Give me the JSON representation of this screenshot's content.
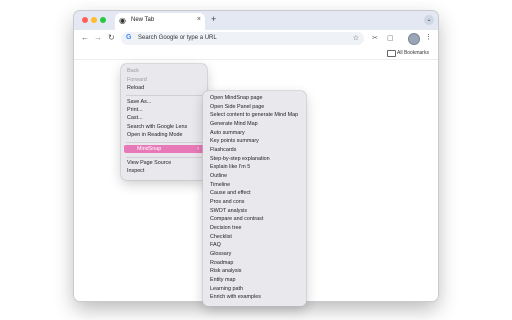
{
  "browser": {
    "tab_title": "New Tab",
    "tab_close": "×",
    "new_tab": "+",
    "omnibox_placeholder": "Search Google or type a URL",
    "bookmarks_label": "All Bookmarks"
  },
  "context_menu": {
    "items": [
      "Back",
      "Forward",
      "Reload",
      "Save As...",
      "Print...",
      "Cast...",
      "Search with Google Lens",
      "Open in Reading Mode",
      "MindSnap",
      "View Page Source",
      "Inspect"
    ]
  },
  "submenu": {
    "items": [
      "Open MindSnap page",
      "Open Side Panel page",
      "Select content to generate Mind Map",
      "Generate Mind Map",
      "Auto summary",
      "Key points summary",
      "Flashcards",
      "Step-by-step explanation",
      "Explain like I'm 5",
      "Outline",
      "Timeline",
      "Cause and effect",
      "Pros and cons",
      "SWOT analysis",
      "Compare and contrast",
      "Decision tree",
      "Checklist",
      "FAQ",
      "Glossary",
      "Roadmap",
      "Risk analysis",
      "Entity map",
      "Learning path",
      "Enrich with examples"
    ]
  },
  "icons": {
    "back": "arrow-left-icon",
    "forward": "arrow-right-icon",
    "reload": "reload-icon",
    "star": "star-icon",
    "chevron": "chevron-right-icon"
  },
  "colors": {
    "highlight": "#e879b8",
    "menu_bg": "#e9e8ec",
    "tabbar_bg": "#e3e8f2"
  }
}
